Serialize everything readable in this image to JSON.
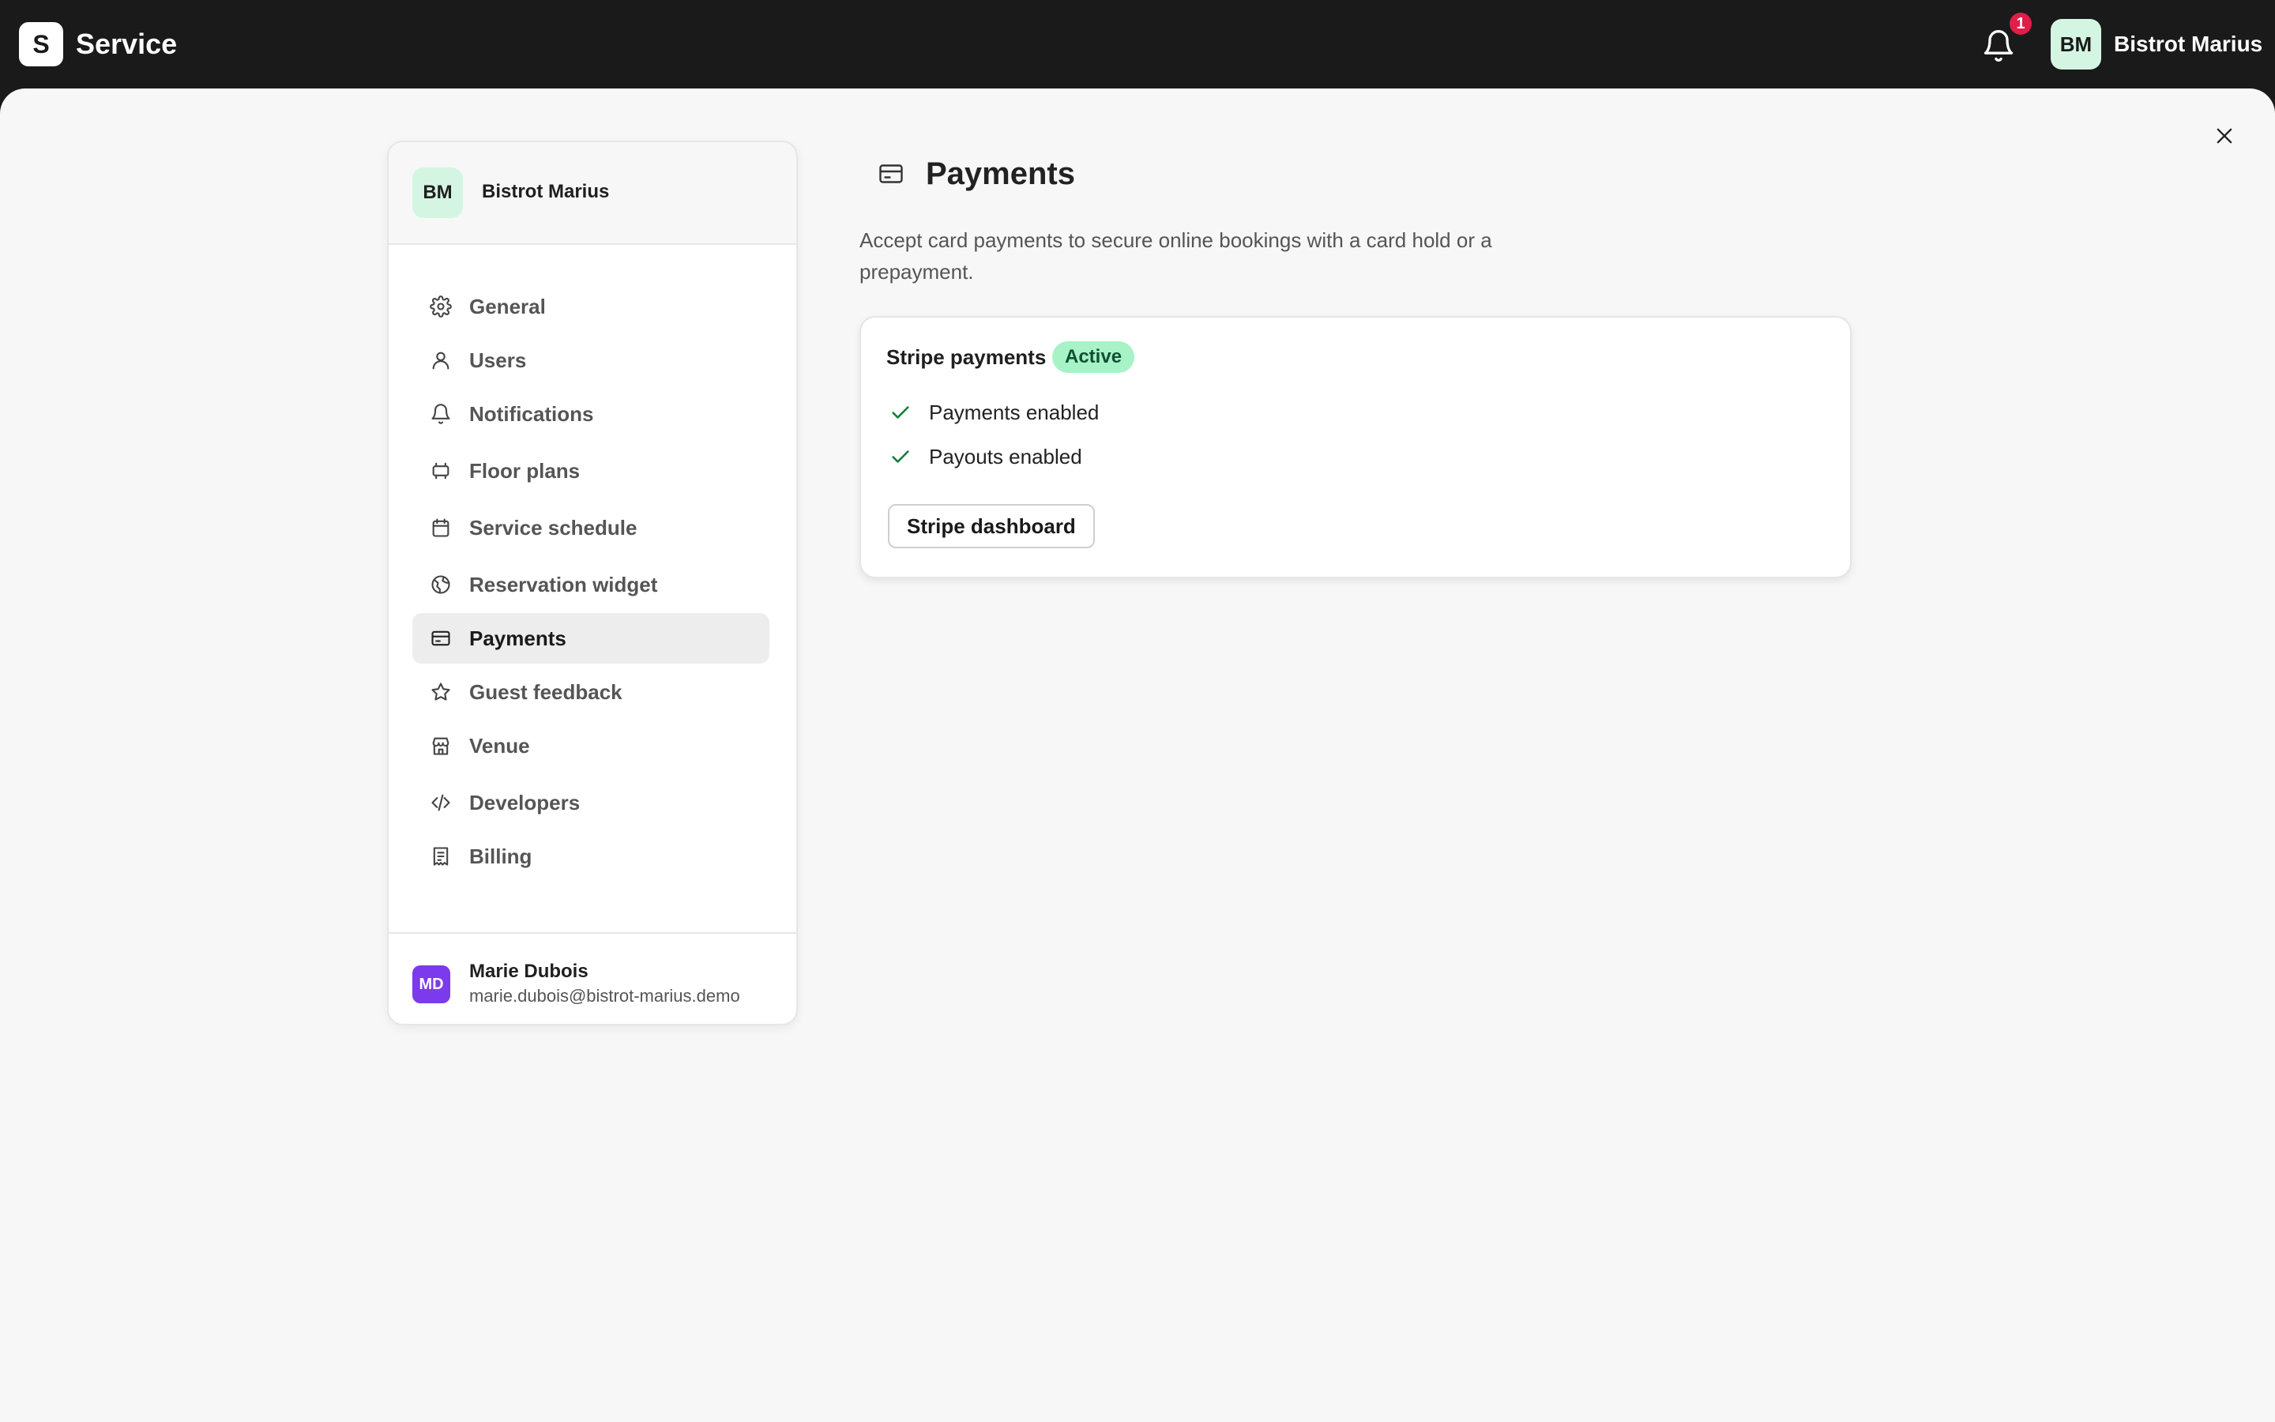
{
  "app": {
    "logo_letter": "S",
    "title": "Service"
  },
  "topbar": {
    "notification_count": "1",
    "avatar_initials": "BM",
    "username": "Bistrot Marius"
  },
  "sidebar": {
    "venue": {
      "initials": "BM",
      "name": "Bistrot Marius"
    },
    "items": [
      {
        "label": "General",
        "icon": "gear-icon"
      },
      {
        "label": "Users",
        "icon": "user-icon"
      },
      {
        "label": "Notifications",
        "icon": "bell-icon"
      },
      {
        "label": "Floor plans",
        "icon": "floor-plan-icon"
      },
      {
        "label": "Service schedule",
        "icon": "calendar-icon"
      },
      {
        "label": "Reservation widget",
        "icon": "globe-icon"
      },
      {
        "label": "Payments",
        "icon": "credit-card-icon",
        "active": true
      },
      {
        "label": "Guest feedback",
        "icon": "star-icon"
      },
      {
        "label": "Venue",
        "icon": "store-icon"
      },
      {
        "label": "Developers",
        "icon": "code-icon"
      },
      {
        "label": "Billing",
        "icon": "receipt-icon"
      }
    ],
    "user": {
      "initials": "MD",
      "name": "Marie Dubois",
      "email": "marie.dubois@bistrot-marius.demo"
    }
  },
  "main": {
    "title": "Payments",
    "description": "Accept card payments to secure online bookings with a card hold or a prepayment.",
    "card": {
      "title": "Stripe payments",
      "status": "Active",
      "checks": [
        "Payments enabled",
        "Payouts enabled"
      ],
      "button_label": "Stripe dashboard"
    }
  },
  "colors": {
    "topbar": "#1a1a1a",
    "active_badge": "#a7f3c7",
    "check": "#15803d",
    "notification_badge": "#e11d48",
    "user_avatar": "#7c3aed"
  }
}
